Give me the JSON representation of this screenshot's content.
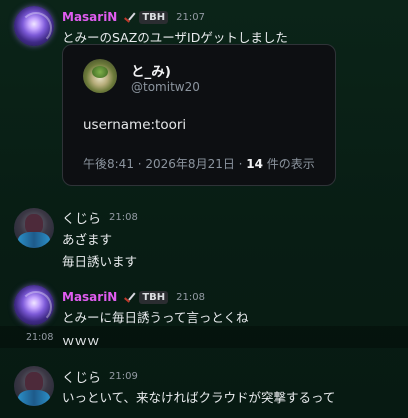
{
  "messages": [
    {
      "author": "MasariN",
      "tag": "TBH",
      "time": "21:07",
      "text": "とみーのSAZのユーザIDゲットしました",
      "embed": {
        "name": "と_み)",
        "handle": "@tomitw20",
        "body": "username:toori",
        "meta_prefix": "午後8:41 · 2026年8月21日 · ",
        "views_count": "14",
        "views_suffix": " 件の表示"
      }
    },
    {
      "author": "くじら",
      "time": "21:08",
      "lines": [
        "あざます",
        "毎日誘います"
      ]
    },
    {
      "author": "MasariN",
      "tag": "TBH",
      "time": "21:08",
      "text": "とみーに毎日誘うって言っとくね",
      "followup": {
        "time": "21:08",
        "text": "ｗｗｗ"
      }
    },
    {
      "author": "くじら",
      "time": "21:09",
      "text": "いっといて、来なければクラウドが突撃するって"
    }
  ],
  "colors": {
    "masari_name": "#e05cf0",
    "background": "#0b2418"
  },
  "icons": {
    "role_badge": "sword-icon"
  }
}
